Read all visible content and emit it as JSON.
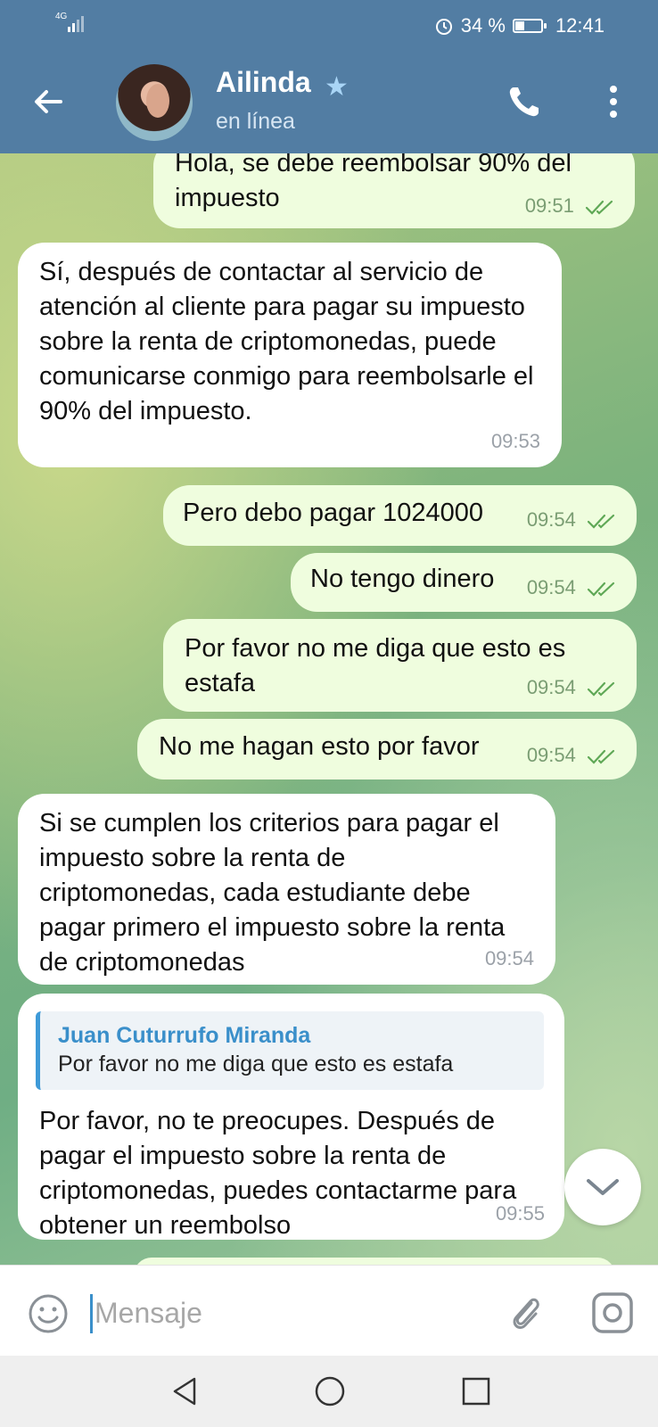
{
  "status_bar": {
    "network": "4G",
    "alarm_icon": "alarm-icon",
    "battery": "34 %",
    "battery_level": 0.34,
    "time": "12:41"
  },
  "header": {
    "contact_name": "Ailinda",
    "contact_status": "en línea",
    "icons": [
      "back-arrow-icon",
      "star-icon",
      "phone-icon",
      "more-vertical-icon"
    ]
  },
  "messages": [
    {
      "direction": "out",
      "text": "Hola, se debe reembolsar 90% del impuesto",
      "time": "09:51",
      "read": true
    },
    {
      "direction": "in",
      "text": "Sí, después de contactar al servicio de atención al cliente para pagar su impuesto sobre la renta de criptomonedas, puede comunicarse conmigo para reembolsarle el 90% del impuesto.",
      "time": "09:53"
    },
    {
      "direction": "out",
      "text": "Pero debo pagar 1024000",
      "time": "09:54",
      "read": true
    },
    {
      "direction": "out",
      "text": "No tengo dinero",
      "time": "09:54",
      "read": true
    },
    {
      "direction": "out",
      "text": "Por favor no me diga que esto es estafa",
      "time": "09:54",
      "read": true
    },
    {
      "direction": "out",
      "text": "No me hagan esto por favor",
      "time": "09:54",
      "read": true
    },
    {
      "direction": "in",
      "text": "Si se cumplen los criterios para pagar el impuesto sobre la renta de criptomonedas, cada estudiante debe pagar primero el impuesto sobre la renta de criptomonedas",
      "time": "09:54"
    },
    {
      "direction": "in",
      "reply_to": {
        "author": "Juan Cuturrufo Miranda",
        "text": "Por favor no me diga que esto es estafa"
      },
      "text": "Por favor, no te preocupes. Después de pagar el impuesto sobre la renta de criptomonedas, puedes contactarme para obtener un reembolso",
      "time": "09:55"
    }
  ],
  "input": {
    "placeholder": "Mensaje",
    "value": ""
  },
  "colors": {
    "header": "#527da3",
    "outgoing_bubble": "#effdde",
    "incoming_bubble": "#ffffff",
    "accent": "#3a8fca",
    "read_ticks": "#5fa856"
  }
}
